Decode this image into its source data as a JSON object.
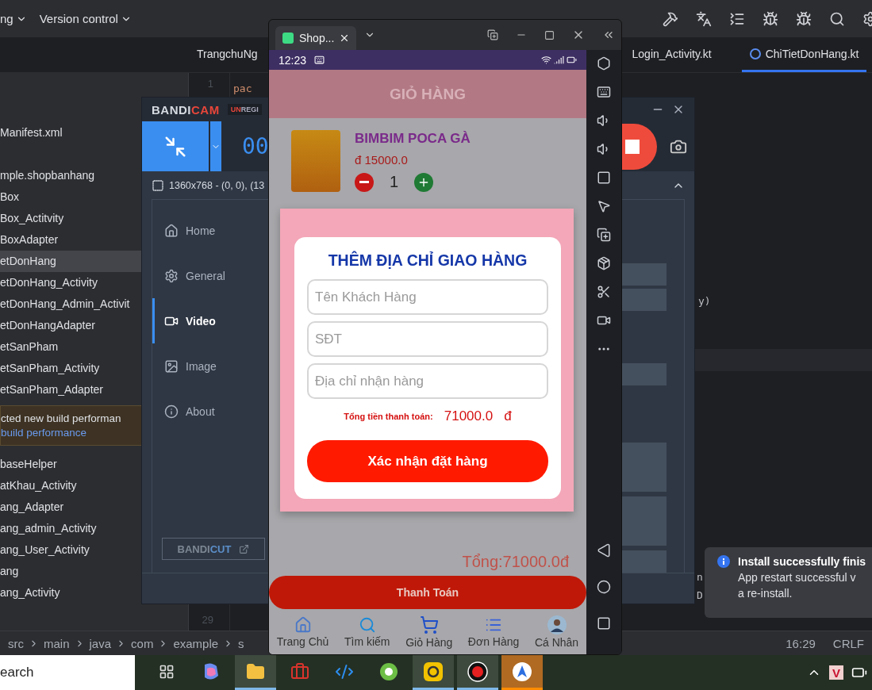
{
  "ide": {
    "menu": [
      {
        "label": "ng"
      },
      {
        "label": "Version control"
      }
    ],
    "editor_tabs": [
      {
        "label": "TrangchuNg",
        "selected": false
      },
      {
        "label": "Login_Activity.kt",
        "selected": false
      },
      {
        "label": "ChiTietDonHang.kt",
        "selected": true
      }
    ],
    "tree_top": [
      {
        "label": "Manifest.xml",
        "selected": false
      }
    ],
    "tree": [
      {
        "label": "mple.shopbanhang",
        "selected": false
      },
      {
        "label": "Box",
        "selected": false
      },
      {
        "label": "Box_Actitvity",
        "selected": false
      },
      {
        "label": "BoxAdapter",
        "selected": false
      },
      {
        "label": "etDonHang",
        "selected": true
      },
      {
        "label": "etDonHang_Activity",
        "selected": false
      },
      {
        "label": "etDonHang_Admin_Activit",
        "selected": false
      },
      {
        "label": "etDonHangAdapter",
        "selected": false
      },
      {
        "label": "etSanPham",
        "selected": false
      },
      {
        "label": "etSanPham_Activity",
        "selected": false
      },
      {
        "label": "etSanPham_Adapter",
        "selected": false
      }
    ],
    "banner": {
      "text": "cted new build performan",
      "link": "build performance"
    },
    "tree_bottom": [
      {
        "label": "baseHelper",
        "selected": false
      },
      {
        "label": "atKhau_Activity",
        "selected": false
      },
      {
        "label": "ang_Adapter",
        "selected": false
      },
      {
        "label": "ang_admin_Activity",
        "selected": false
      },
      {
        "label": "ang_User_Activity",
        "selected": false
      },
      {
        "label": "ang",
        "selected": false
      },
      {
        "label": "ang_Activity",
        "selected": false
      }
    ],
    "line_numbers": [
      "1",
      "29"
    ],
    "code": [
      {
        "text": "pac"
      },
      {
        "text": "y)"
      },
      {
        "text": "n"
      },
      {
        "text": "D"
      }
    ],
    "breadcrumbs": [
      "src",
      "main",
      "java",
      "com",
      "example",
      "s"
    ],
    "status": [
      "16:29",
      "CRLF"
    ],
    "toast": {
      "title": "Install successfully finis",
      "lines": [
        "App restart successful v",
        "a re-install."
      ]
    }
  },
  "bandicam": {
    "logo_a": "BANDI",
    "logo_b": "CAM",
    "badge_a": "UN",
    "badge_b": "REGI",
    "timer": "00",
    "resolution": "1360x768 - (0, 0), (13",
    "nav": [
      {
        "label": "Home",
        "selected": false
      },
      {
        "label": "General",
        "selected": false
      },
      {
        "label": "Video",
        "selected": true
      },
      {
        "label": "Image",
        "selected": false
      },
      {
        "label": "About",
        "selected": false
      }
    ],
    "bandicut_a": "BANDI",
    "bandicut_b": "CUT"
  },
  "emulator": {
    "tab": "Shop...",
    "time": "12:23",
    "header": "GIỎ HÀNG",
    "product": {
      "name": "BIMBIM POCA GÀ",
      "price": "đ 15000.0",
      "qty": "1"
    },
    "dialog": {
      "title": "THÊM ĐỊA CHỈ GIAO HÀNG",
      "fields": [
        {
          "placeholder": "Tên Khách Hàng"
        },
        {
          "placeholder": "SĐT"
        },
        {
          "placeholder": "Địa chỉ nhận hàng"
        }
      ],
      "total_label": "Tổng tiền thanh toán:",
      "total": "71000.0",
      "currency": "đ",
      "confirm": "Xác nhận đặt hàng"
    },
    "total": "Tổng:71000.0đ",
    "pay": "Thanh Toán",
    "nav": [
      {
        "label": "Trang Chủ"
      },
      {
        "label": "Tìm kiếm"
      },
      {
        "label": "Giỏ Hàng"
      },
      {
        "label": "Đơn Hàng"
      },
      {
        "label": "Cá Nhân"
      }
    ]
  },
  "taskbar": {
    "search": "earch",
    "tray_badge": "V",
    "apps": [
      {
        "running": false,
        "selected": false
      },
      {
        "running": false,
        "selected": false
      },
      {
        "running": true,
        "selected": false
      },
      {
        "running": false,
        "selected": false
      },
      {
        "running": false,
        "selected": false
      },
      {
        "running": false,
        "selected": false
      },
      {
        "running": true,
        "selected": false
      },
      {
        "running": true,
        "selected": false
      },
      {
        "running": true,
        "selected": true
      }
    ]
  }
}
